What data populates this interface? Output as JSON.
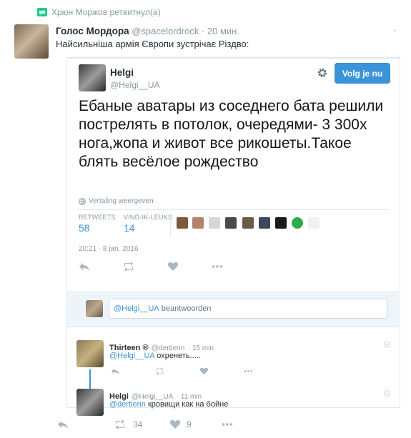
{
  "retweet_header": {
    "text": "Хрюн Моржов ретвитнул(а)"
  },
  "outer_tweet": {
    "name": "Голос Мордора",
    "handle": "@spacelordrock",
    "time": "· 20 мин.",
    "text": "Найсильніша армія Європи зустрічає Різдво:",
    "chevron": "⌄"
  },
  "quoted_tweet": {
    "name": "Helgi",
    "handle": "@Helgi__UA",
    "follow_label": "Volg je nu",
    "text": "Ебаные аватары из соседнего бата решили пострелять в потолок, очередями- 3 300х нога,жопа и живот все рикошеты.Такое блять весёлое рождество",
    "translate_label": "Vertaling weergeven",
    "stats": {
      "retweets_label": "RETWEETS",
      "retweets_value": "58",
      "likes_label": "VIND-IK-LEUKS",
      "likes_value": "14"
    },
    "date": "20:21 - 8 jan. 2016"
  },
  "reply_box": {
    "mention": "@Helgi__UA",
    "placeholder_rest": "beantwoorden"
  },
  "replies": [
    {
      "name": "Thirteen ®",
      "handle": "@dertienn",
      "time": "· 15 min",
      "mention": "@Helgi__UA",
      "text": " охренеть....."
    },
    {
      "name": "Helgi",
      "handle": "@Helgi__UA",
      "time": "· 11 min",
      "mention": "@dertienn",
      "text": " кровищи как на бойне"
    }
  ],
  "bottom_actions": {
    "retweet_count": "34",
    "like_count": "9"
  },
  "colors": {
    "accent": "#3b94d9",
    "retweet_green": "#19cf86",
    "muted": "#8899a6"
  },
  "icons": [
    "retweet-icon",
    "gear-icon",
    "globe-icon",
    "reply-icon",
    "like-icon",
    "more-icon",
    "chevron-down-icon"
  ]
}
